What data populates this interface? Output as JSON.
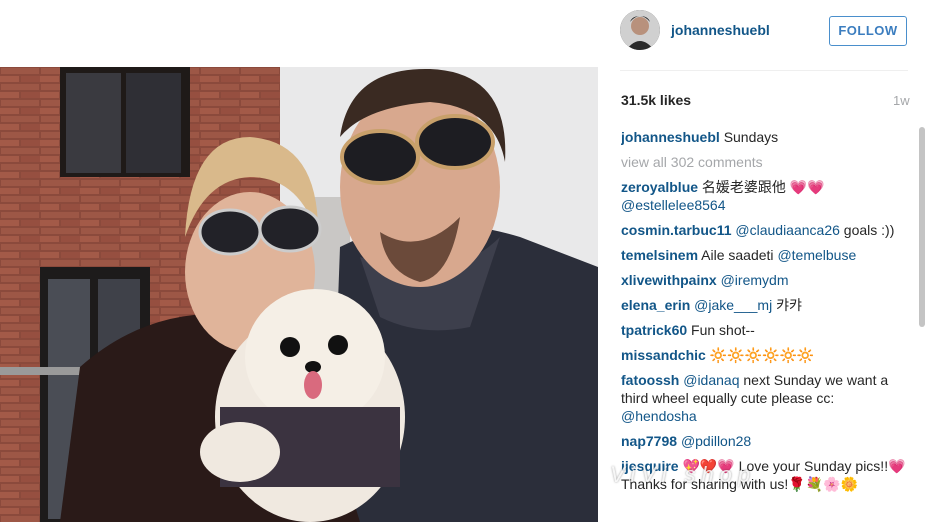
{
  "post": {
    "username": "johanneshuebl",
    "follow_label": "FOLLOW",
    "likes": "31.5k likes",
    "age": "1w",
    "caption_user": "johanneshuebl",
    "caption_text": "Sundays",
    "view_all": "view all 302 comments"
  },
  "comments": [
    {
      "user": "zeroyalblue",
      "text": " 名媛老婆跟他 💗💗",
      "mention": "@estellelee8564"
    },
    {
      "user": "cosmin.tarbuc11",
      "mention": "@claudiaanca26",
      "text": " goals :))"
    },
    {
      "user": "temelsinem",
      "text": " Aile saadeti ",
      "mention": "@temelbuse"
    },
    {
      "user": "xlivewithpainx",
      "mention": "@iremydm",
      "text": ""
    },
    {
      "user": "elena_erin",
      "mention": "@jake___mj",
      "text": " 캬캬"
    },
    {
      "user": "tpatrick60",
      "text": " Fun shot--",
      "mention": ""
    },
    {
      "user": "missandchic",
      "text": " 🔆🔆🔆🔆🔆🔆",
      "mention": ""
    },
    {
      "user": "fatoossh",
      "mention": "@idanaq",
      "text": " next Sunday we want a third wheel equally cute please cc: ",
      "mention2": "@hendosha"
    },
    {
      "user": "nap7798",
      "mention": "@pdillon28",
      "text": ""
    },
    {
      "user": "ijesquire",
      "text": " 💖❤️💗 Love your Sunday pics!!💗 Thanks for sharing with us!🌹💐🌸🌼",
      "mention": ""
    }
  ],
  "watermark": "ViVi shop",
  "colors": {
    "link": "#125688",
    "follow": "#3b7dbf",
    "muted": "#a5a7aa"
  },
  "icons": {
    "avatar": "user-avatar"
  }
}
